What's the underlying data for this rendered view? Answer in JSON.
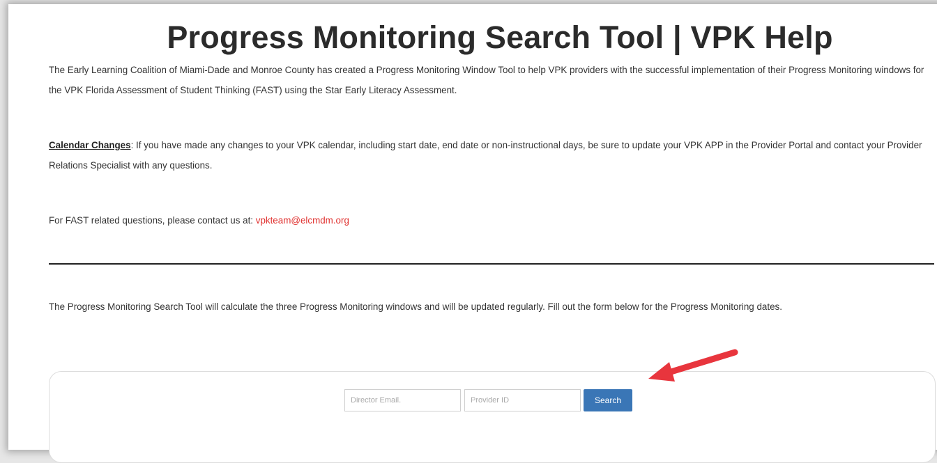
{
  "page": {
    "title": "Progress Monitoring Search Tool | VPK Help",
    "intro": "The Early Learning Coalition of Miami-Dade and Monroe County has created a Progress Monitoring Window Tool to help VPK providers with the successful implementation of their Progress Monitoring windows for the VPK Florida Assessment of Student Thinking (FAST) using the Star Early Literacy Assessment.",
    "calendar_label": "Calendar Changes",
    "calendar_text": ": If you have made any changes to your VPK calendar, including start date, end date or non-instructional days, be sure to update your VPK APP in the Provider Portal and contact your Provider Relations Specialist with any questions.",
    "contact_text": "For FAST related questions, please contact us at: ",
    "contact_email": "vpkteam@elcmdm.org",
    "tool_description": "The Progress Monitoring Search Tool will calculate the three Progress Monitoring windows and will be updated regularly. Fill out the form below for the Progress Monitoring dates."
  },
  "search_form": {
    "email_placeholder": "Director Email.",
    "provider_placeholder": "Provider ID",
    "search_label": "Search"
  },
  "colors": {
    "button": "#3a76b6",
    "link": "#e0312f",
    "arrow": "#e8353d"
  }
}
